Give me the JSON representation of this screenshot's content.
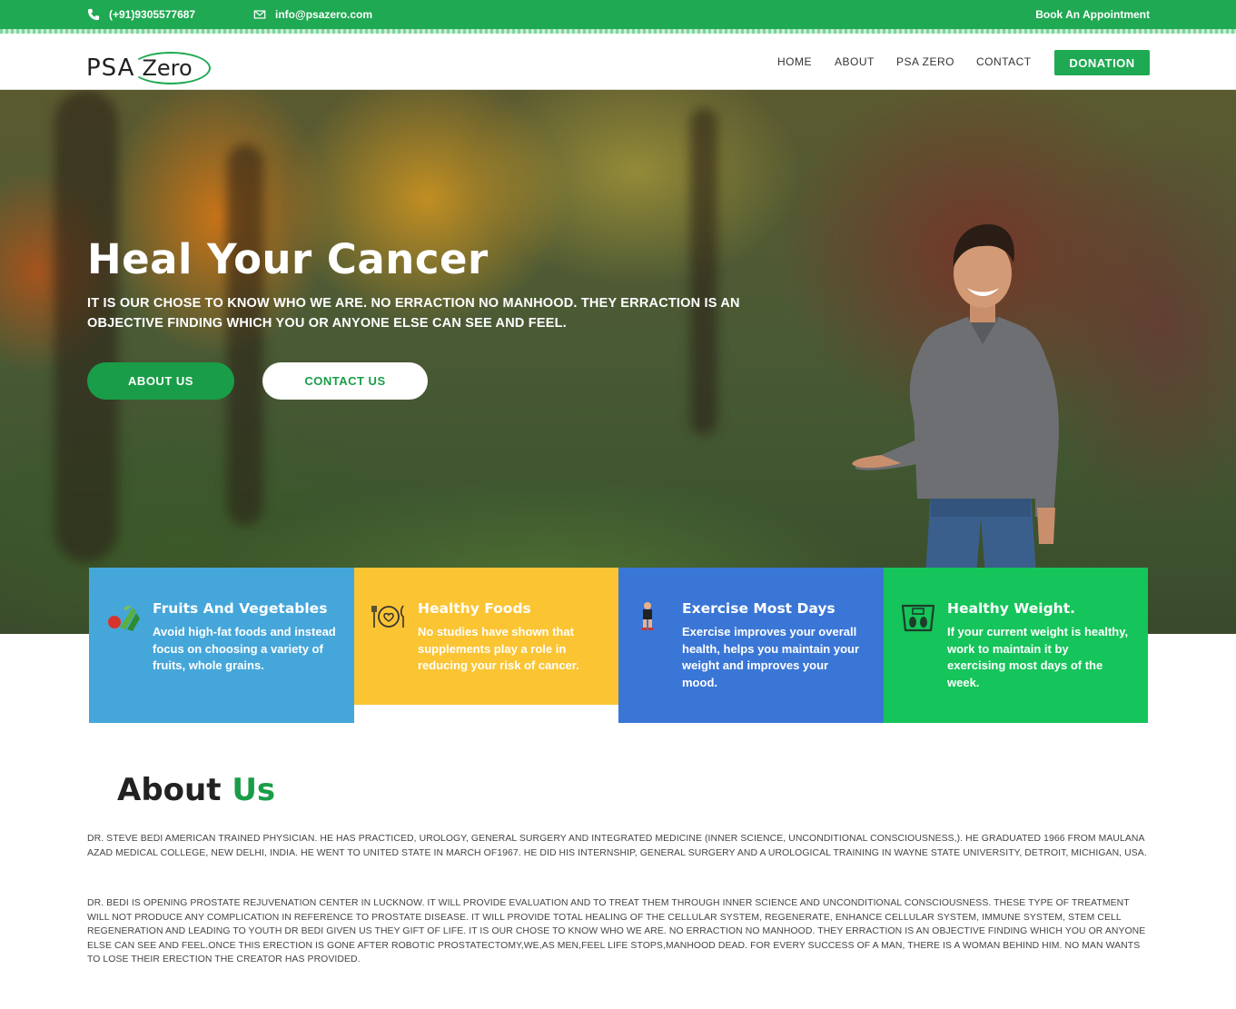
{
  "topbar": {
    "phone": "(+91)9305577687",
    "email": "info@psazero.com",
    "appointment": "Book An Appointment"
  },
  "header": {
    "logo_psa": "PSA",
    "logo_zero": "Zero",
    "nav": [
      "HOME",
      "ABOUT",
      "PSA ZERO",
      "CONTACT"
    ],
    "donation": "DONATION"
  },
  "hero": {
    "title": "Heal Your Cancer",
    "subtitle": "IT IS OUR CHOSE TO KNOW WHO WE ARE. NO ERRACTION NO MANHOOD. THEY ERRACTION IS AN OBJECTIVE FINDING WHICH YOU OR ANYONE ELSE CAN SEE AND FEEL.",
    "about_button": "ABOUT US",
    "contact_button": "CONTACT US"
  },
  "features": [
    {
      "title": "Fruits And Vegetables",
      "text": "Avoid high-fat foods and instead focus on choosing a variety of fruits, whole grains.",
      "icon": "fruits-icon"
    },
    {
      "title": "Healthy Foods",
      "text": "No studies have shown that supplements play a role in reducing your risk of cancer.",
      "icon": "plate-icon"
    },
    {
      "title": "Exercise Most Days",
      "text": "Exercise improves your overall health, helps you maintain your weight and improves your mood.",
      "icon": "runner-icon"
    },
    {
      "title": "Healthy Weight.",
      "text": "If your current weight is healthy, work to maintain it by exercising most days of the week.",
      "icon": "scale-icon"
    }
  ],
  "about": {
    "title_main": "About",
    "title_accent": "Us",
    "p1": "DR. STEVE BEDI AMERICAN TRAINED PHYSICIAN. HE HAS PRACTICED, UROLOGY, GENERAL SURGERY AND INTEGRATED MEDICINE (INNER SCIENCE, UNCONDITIONAL CONSCIOUSNESS,). HE GRADUATED 1966 FROM MAULANA AZAD MEDICAL COLLEGE, NEW DELHI, INDIA. HE WENT TO UNITED STATE IN MARCH OF1967. HE DID HIS INTERNSHIP, GENERAL SURGERY AND A UROLOGICAL TRAINING IN WAYNE STATE UNIVERSITY, DETROIT, MICHIGAN, USA.",
    "p2": "DR. BEDI IS OPENING PROSTATE REJUVENATION CENTER IN LUCKNOW. IT WILL PROVIDE EVALUATION AND TO TREAT THEM THROUGH INNER SCIENCE AND UNCONDITIONAL CONSCIOUSNESS. THESE TYPE OF TREATMENT WILL NOT PRODUCE ANY COMPLICATION IN REFERENCE TO PROSTATE DISEASE. IT WILL PROVIDE TOTAL HEALING OF THE CELLULAR SYSTEM, REGENERATE, ENHANCE CELLULAR SYSTEM, IMMUNE SYSTEM, STEM CELL REGENERATION AND LEADING TO YOUTH DR BEDI GIVEN US THEY GIFT OF LIFE. IT IS OUR CHOSE TO KNOW WHO WE ARE. NO ERRACTION NO MANHOOD. THEY ERRACTION IS AN OBJECTIVE FINDING WHICH YOU OR ANYONE ELSE CAN SEE AND FEEL.ONCE THIS ERECTION IS GONE AFTER ROBOTIC PROSTATECTOMY,WE,AS MEN,FEEL LIFE STOPS,MANHOOD DEAD. FOR EVERY SUCCESS OF A MAN, THERE IS A WOMAN BEHIND HIM. NO MAN WANTS TO LOSE THEIR ERECTION THE CREATOR HAS PROVIDED."
  },
  "colors": {
    "brand_green": "#1fa952",
    "card_blue": "#45a6da",
    "card_yellow": "#fbc433",
    "card_royal": "#3a76d6",
    "card_green": "#15c45a"
  }
}
